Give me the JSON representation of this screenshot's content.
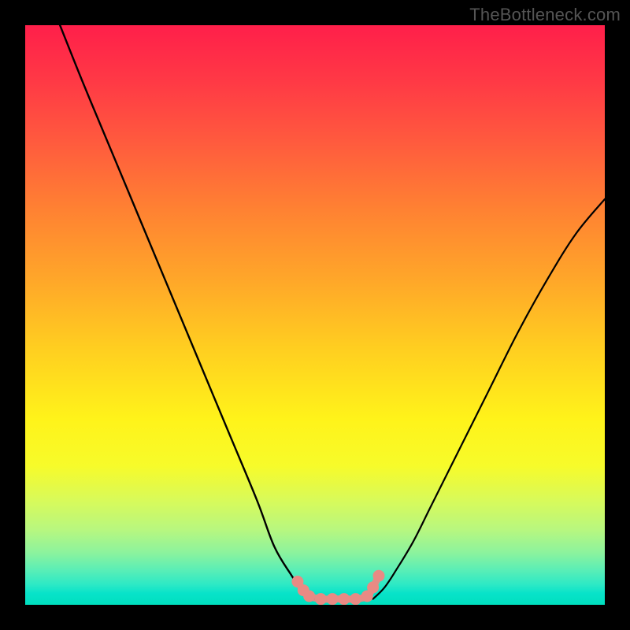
{
  "watermark": "TheBottleneck.com",
  "chart_data": {
    "type": "line",
    "title": "",
    "xlabel": "",
    "ylabel": "",
    "xlim": [
      0,
      100
    ],
    "ylim": [
      0,
      100
    ],
    "grid": false,
    "legend": false,
    "series": [
      {
        "name": "left-curve",
        "x": [
          6,
          10,
          15,
          20,
          25,
          30,
          35,
          40,
          43,
          46,
          48,
          50
        ],
        "y": [
          100,
          90,
          78,
          66,
          54,
          42,
          30,
          18,
          10,
          5,
          2,
          1
        ]
      },
      {
        "name": "right-curve",
        "x": [
          60,
          62,
          64,
          67,
          70,
          75,
          80,
          85,
          90,
          95,
          100
        ],
        "y": [
          1,
          3,
          6,
          11,
          17,
          27,
          37,
          47,
          56,
          64,
          70
        ]
      },
      {
        "name": "trough-markers",
        "type": "scatter",
        "x": [
          47,
          48,
          49,
          51,
          53,
          55,
          57,
          59,
          60,
          61
        ],
        "y": [
          4,
          2.5,
          1.5,
          1,
          1,
          1,
          1,
          1.5,
          3,
          5
        ]
      }
    ],
    "marker_color": "#e98a84",
    "curve_color": "#000000"
  }
}
